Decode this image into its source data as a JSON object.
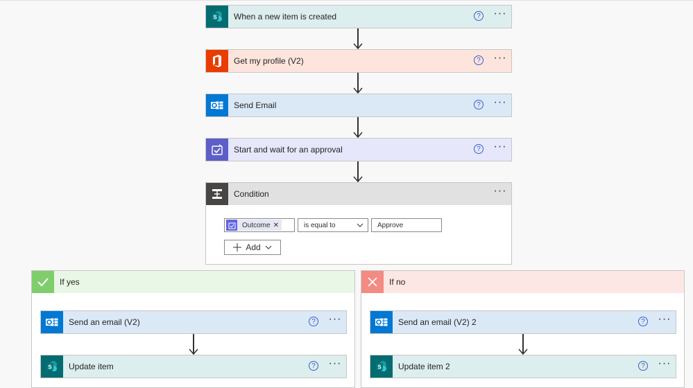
{
  "flow": {
    "steps": [
      {
        "title": "When a new item is created",
        "icon": "sharepoint-icon",
        "header_color": "#dceeed",
        "icon_color": "#036c70"
      },
      {
        "title": "Get my profile (V2)",
        "icon": "office-icon",
        "header_color": "#fde4dc",
        "icon_color": "#eb3c00"
      },
      {
        "title": "Send Email",
        "icon": "outlook-icon",
        "header_color": "#dbe9f7",
        "icon_color": "#0078d4"
      },
      {
        "title": "Start and wait for an approval",
        "icon": "approvals-icon",
        "header_color": "#e6e7fb",
        "icon_color": "#5b5fc7"
      }
    ],
    "condition": {
      "title": "Condition",
      "icon": "condition-icon",
      "header_color": "#e1e1e1",
      "icon_color": "#484644",
      "left_operand": "Outcome",
      "operator": "is equal to",
      "right_operand": "Approve",
      "add_label": "Add"
    },
    "branches": {
      "yes": {
        "title": "If yes",
        "header_color": "#e9f7e6",
        "icon_color": "#7fce6b",
        "actions": [
          {
            "title": "Send an email (V2)",
            "icon": "outlook-icon",
            "header_color": "#dbe9f7",
            "icon_color": "#0078d4"
          },
          {
            "title": "Update item",
            "icon": "sharepoint-icon",
            "header_color": "#dceeed",
            "icon_color": "#036c70"
          }
        ]
      },
      "no": {
        "title": "If no",
        "header_color": "#fde7e4",
        "icon_color": "#f28b82",
        "actions": [
          {
            "title": "Send an email (V2) 2",
            "icon": "outlook-icon",
            "header_color": "#dbe9f7",
            "icon_color": "#0078d4"
          },
          {
            "title": "Update item 2",
            "icon": "sharepoint-icon",
            "header_color": "#dceeed",
            "icon_color": "#036c70"
          }
        ]
      }
    },
    "help_glyph": "?",
    "more_glyph": "···"
  }
}
